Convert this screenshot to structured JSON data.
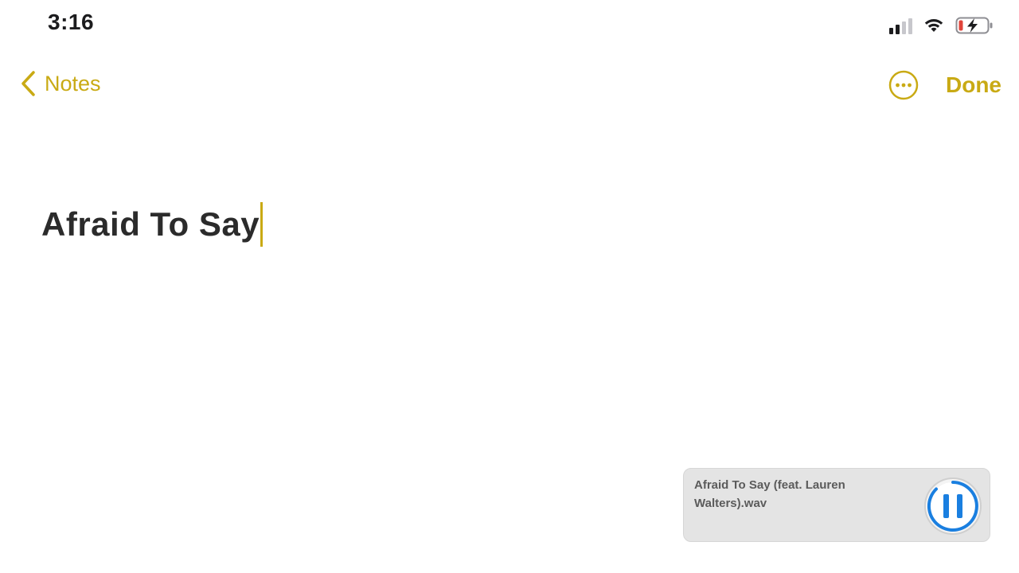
{
  "status_bar": {
    "time": "3:16",
    "signal_icon": "cellular-signal-icon",
    "wifi_icon": "wifi-icon",
    "battery_icon": "battery-charging-icon"
  },
  "nav": {
    "back_label": "Notes",
    "back_icon": "chevron-left-icon",
    "more_icon": "ellipsis-circle-icon",
    "done_label": "Done"
  },
  "note": {
    "title": "Afraid To Say"
  },
  "player": {
    "filename": "Afraid To Say (feat. Lauren Walters).wav",
    "control_icon": "pause-icon"
  },
  "colors": {
    "accent": "#c9aa14",
    "player_control": "#1a7fe0",
    "player_background": "#e4e4e4"
  }
}
